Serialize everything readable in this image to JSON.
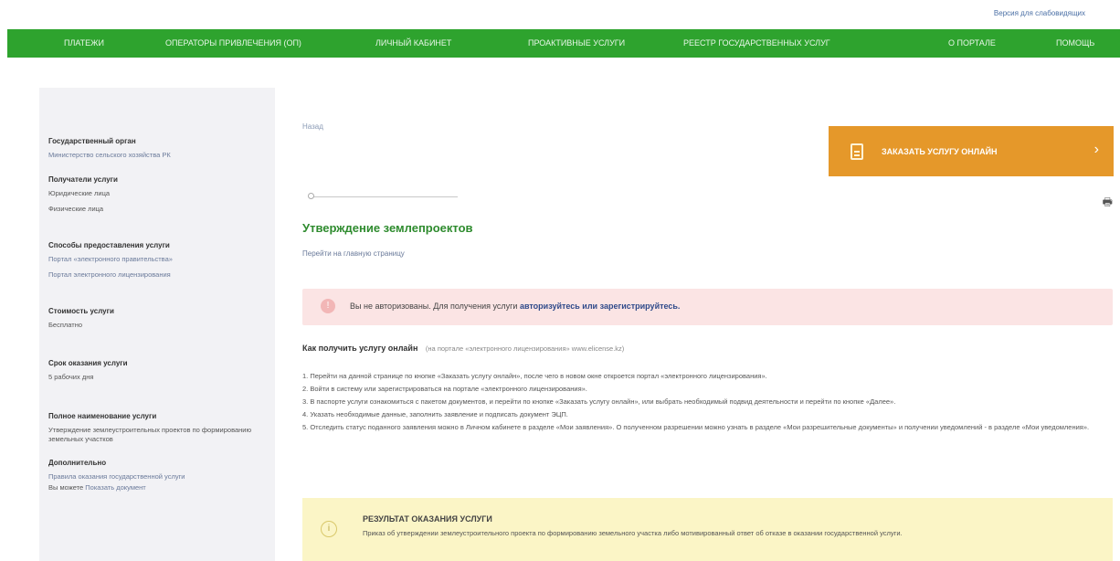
{
  "topbar": {
    "accessibility_link": "Версия для слабовидящих"
  },
  "nav": {
    "items": [
      "Платежи",
      "Операторы привлечения (ОП)",
      "Личный кабинет",
      "Проактивные услуги",
      "Реестр государственных услуг",
      "О портале",
      "Помощь"
    ]
  },
  "sidebar": {
    "organ_head": "Государственный орган",
    "organ_value": "Министерство сельского хозяйства РК",
    "recipient_head": "Получатели услуги",
    "recipient_1": "Юридические лица",
    "recipient_2": "Физические лица",
    "method_head": "Способы предоставления услуги",
    "method_1": "Портал «электронного правительства»",
    "method_2": "Портал электронного лицензирования",
    "cost_head": "Стоимость услуги",
    "cost_value": "Бесплатно",
    "term_head": "Срок оказания услуги",
    "term_value": "5 рабочих дня",
    "fullname_head": "Полное наименование услуги",
    "fullname_value": "Утверждение землеустроительных проектов по формированию земельных участков",
    "extra_head": "Дополнительно",
    "extra_1": "Правила оказания государственной услуги",
    "extra_2_prefix": "Вы можете",
    "extra_2_link": "Показать документ"
  },
  "main": {
    "breadcrumb": "Назад",
    "order_button": "Заказать услугу онлайн",
    "title": "Утверждение землепроектов",
    "backlink": "Перейти на главную страницу",
    "alert_text": "Вы не авторизованы. Для получения услуги",
    "alert_link": "авторизуйтесь или зарегистрируйтесь.",
    "howto_title": "Как получить услугу онлайн",
    "howto_note": "(на портале «электронного лицензирования» www.elicense.kz)",
    "steps": [
      "1. Перейти на данной странице по кнопке «Заказать услугу онлайн», после чего в новом окне откроется портал «электронного лицензирования».",
      "2. Войти в систему или зарегистрироваться на портале «электронного лицензирования».",
      "3. В паспорте услуги ознакомиться с пакетом документов, и перейти по кнопке «Заказать услугу онлайн», или выбрать необходимый подвид деятельности и перейти по кнопке «Далее».",
      "4. Указать необходимые данные, заполнить заявление и подписать документ ЭЦП.",
      "5. Отследить статус поданного заявления можно в Личном кабинете в разделе «Мои заявления». О полученном разрешении можно узнать в разделе «Мои разрешительные документы» и получении уведомлений - в разделе «Мои уведомления»."
    ],
    "result_title": "Результат оказания услуги",
    "result_body": "Приказ об утверждении землеустроительного проекта по формированию земельного участка либо мотивированный ответ об отказе в оказании государственной услуги."
  }
}
